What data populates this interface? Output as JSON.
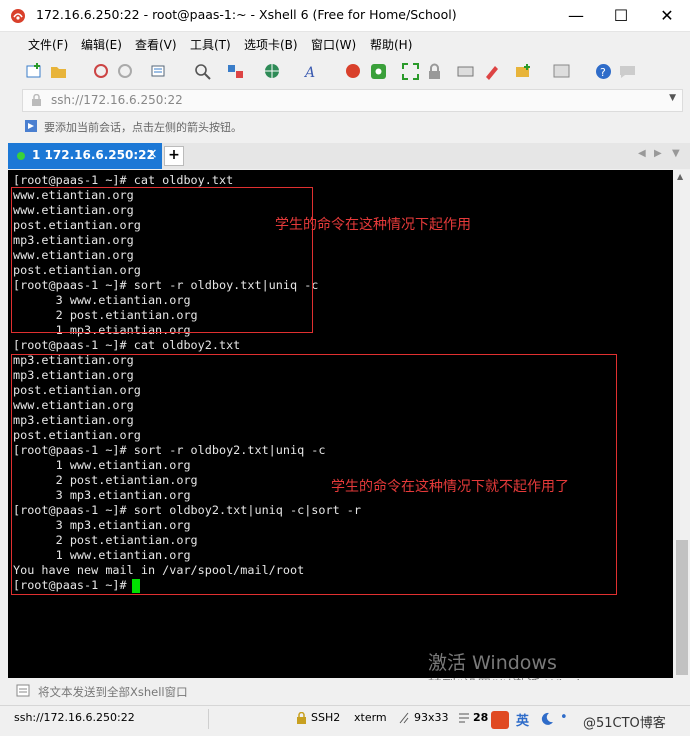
{
  "window": {
    "title": "172.16.6.250:22 - root@paas-1:~ - Xshell 6 (Free for Home/School)",
    "minimize": "—",
    "maximize": "☐",
    "close": "✕"
  },
  "menu": [
    "文件(F)",
    "编辑(E)",
    "查看(V)",
    "工具(T)",
    "选项卡(B)",
    "窗口(W)",
    "帮助(H)"
  ],
  "address": {
    "value": "ssh://172.16.6.250:22"
  },
  "hint": "要添加当前会话，点击左侧的箭头按钮。",
  "tab": {
    "label": "1 172.16.6.250:22",
    "close": "×",
    "add": "+"
  },
  "terminal": {
    "lines": [
      "[root@paas-1 ~]# cat oldboy.txt",
      "www.etiantian.org",
      "www.etiantian.org",
      "post.etiantian.org",
      "mp3.etiantian.org",
      "www.etiantian.org",
      "post.etiantian.org",
      "[root@paas-1 ~]# sort -r oldboy.txt|uniq -c",
      "      3 www.etiantian.org",
      "      2 post.etiantian.org",
      "      1 mp3.etiantian.org",
      "[root@paas-1 ~]# cat oldboy2.txt",
      "mp3.etiantian.org",
      "mp3.etiantian.org",
      "post.etiantian.org",
      "www.etiantian.org",
      "mp3.etiantian.org",
      "post.etiantian.org",
      "[root@paas-1 ~]# sort -r oldboy2.txt|uniq -c",
      "      1 www.etiantian.org",
      "      2 post.etiantian.org",
      "      3 mp3.etiantian.org",
      "[root@paas-1 ~]# sort oldboy2.txt|uniq -c|sort -r",
      "      3 mp3.etiantian.org",
      "      2 post.etiantian.org",
      "      1 www.etiantian.org",
      "You have new mail in /var/spool/mail/root",
      "[root@paas-1 ~]# "
    ],
    "annotation1": "学生的命令在这种情况下起作用",
    "annotation2": "学生的命令在这种情况下就不起作用了",
    "cursor_color": "#00e000",
    "annotation_color": "#e53a3a"
  },
  "watermark": {
    "line1": "激活 Windows",
    "line2": "转到“设置”以激活 Windows。"
  },
  "compose": {
    "placeholder": "将文本发送到全部Xshell窗口"
  },
  "status": {
    "connection": "ssh://172.16.6.250:22",
    "protocol": "SSH2",
    "term": "xterm",
    "size": "93x33",
    "cursor_pos": "28",
    "ime": "英",
    "blog": "@51CTO博客"
  },
  "colors": {
    "tab_active": "#1c78d6",
    "terminal_bg": "#000000",
    "title_icon": "#d9402b"
  }
}
